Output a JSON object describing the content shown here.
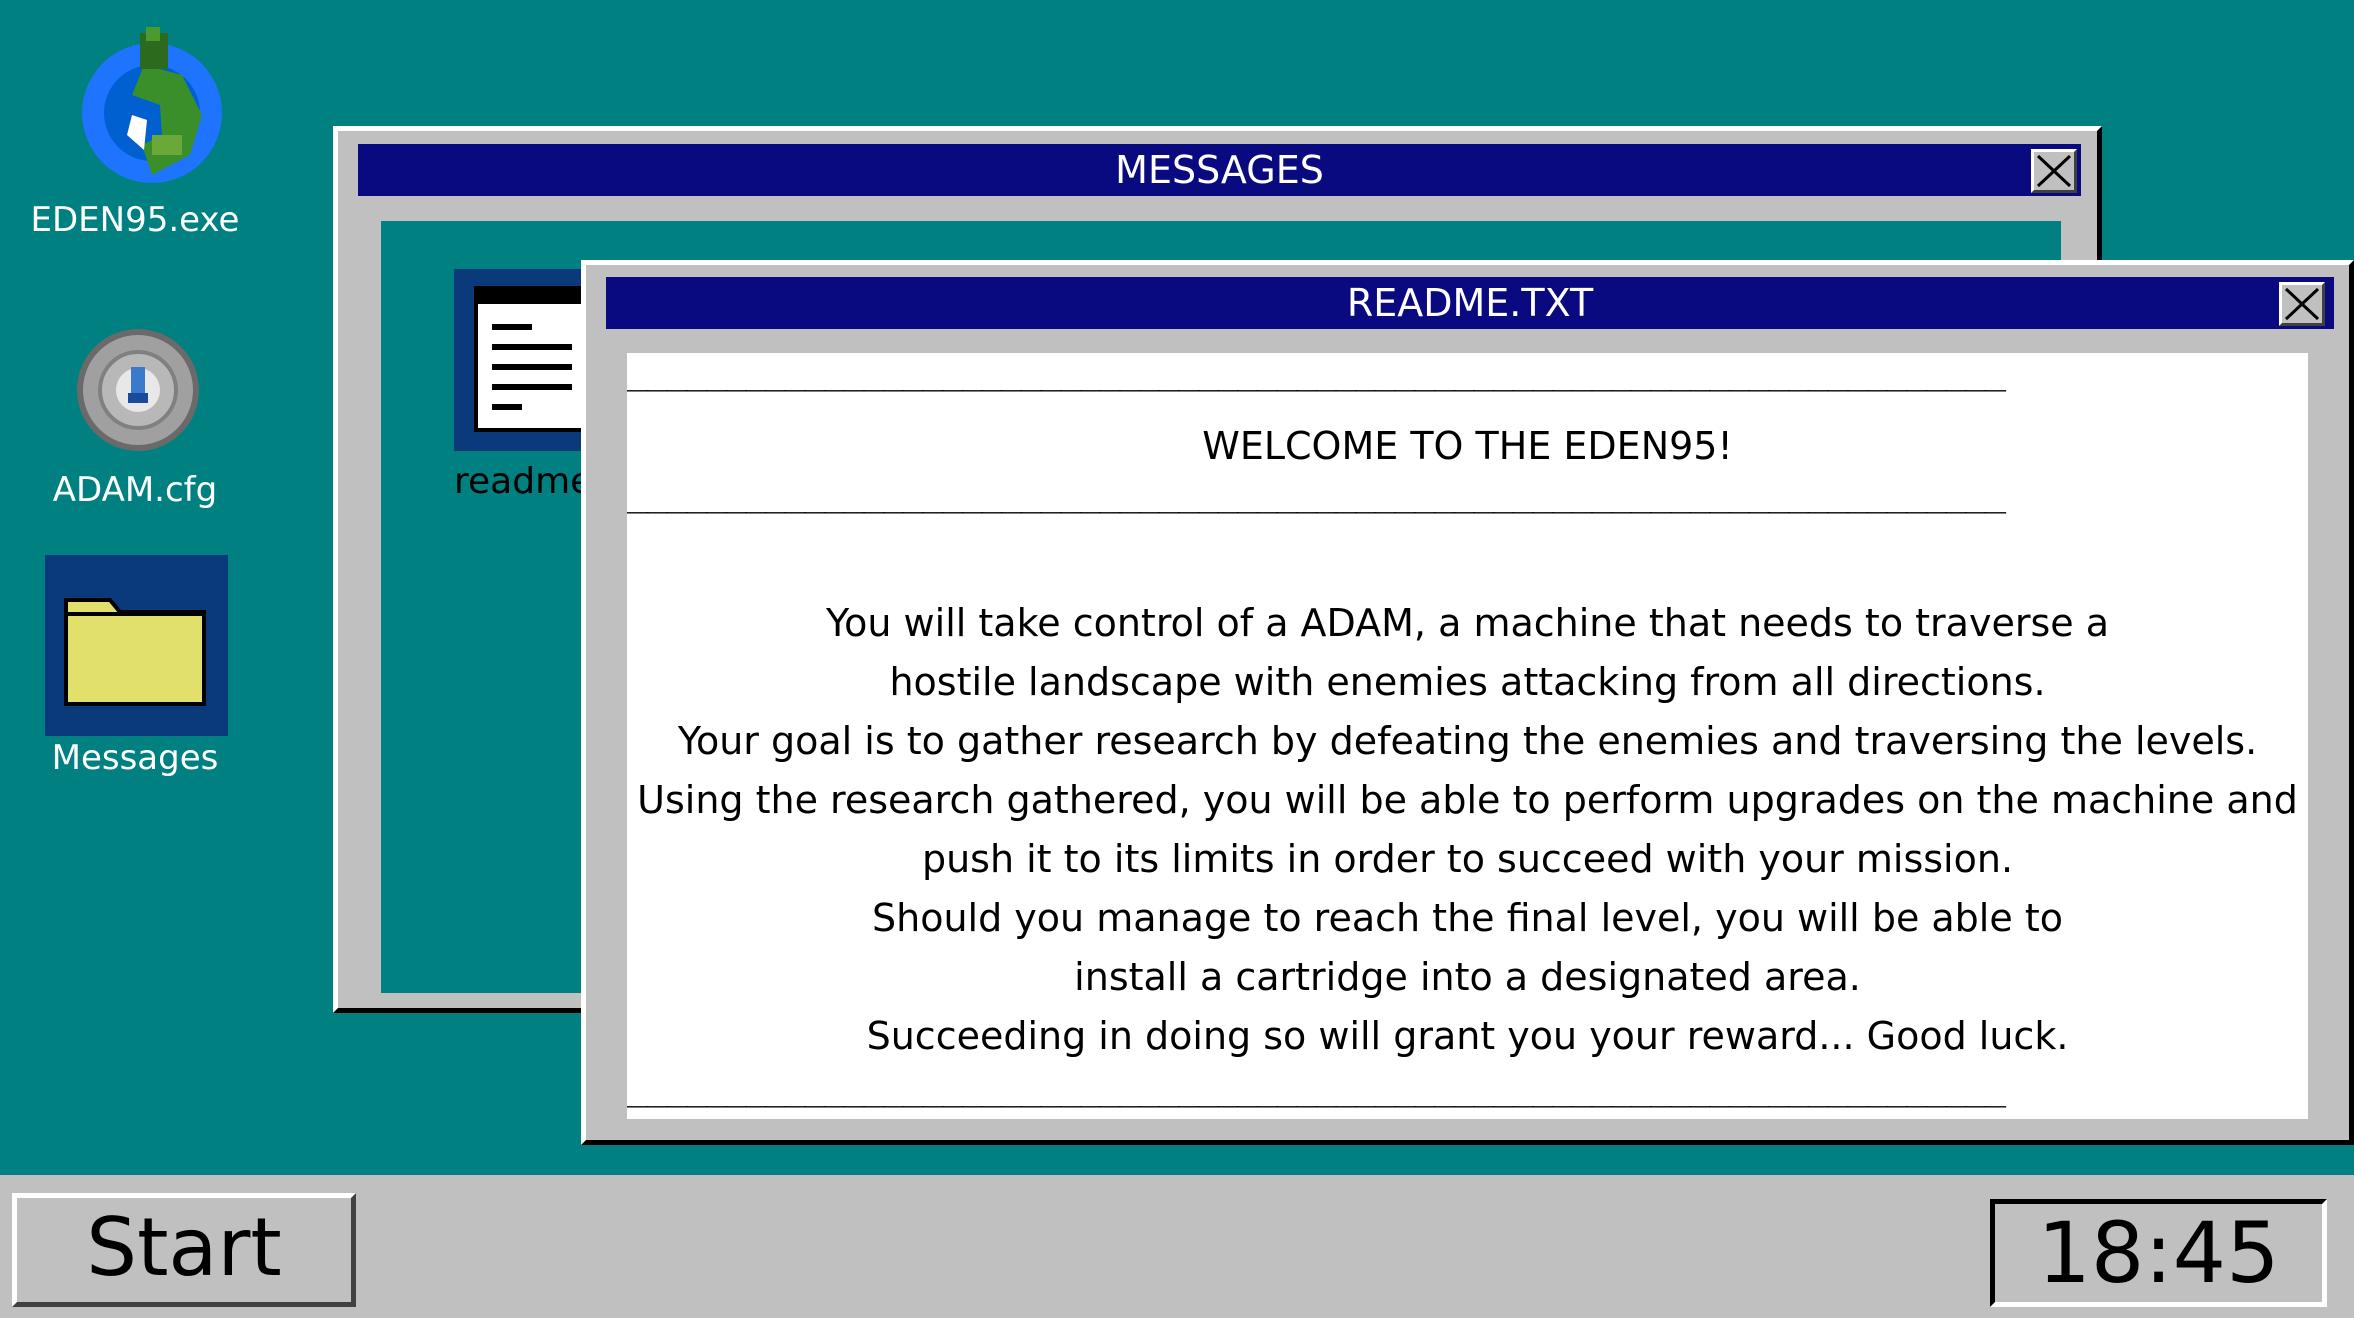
{
  "desktop": {
    "background": "#008080",
    "icons": [
      {
        "label": "EDEN95.exe",
        "icon": "globe-icon"
      },
      {
        "label": "ADAM.cfg",
        "icon": "settings-disc-icon"
      },
      {
        "label": "Messages",
        "icon": "folder-icon"
      }
    ]
  },
  "messages_window": {
    "title": "MESSAGES",
    "file_label": "readme",
    "file_icon": "text-document-icon"
  },
  "readme_window": {
    "title": "README.TXT",
    "separator": "______________________________________________________________________",
    "heading": "WELCOME TO THE EDEN95!",
    "lines": [
      "You will take control of a ADAM, a machine that needs to traverse a",
      "hostile landscape with enemies attacking from all directions.",
      "Your goal is to gather research by defeating the enemies and traversing the levels.",
      "Using the research gathered, you will be able to perform upgrades on the machine and",
      "push it to its limits in order to succeed with your mission.",
      "Should you manage to reach the final level, you will be able to",
      "install a cartridge into a designated area.",
      "Succeeding in doing so will grant you your reward... Good luck."
    ]
  },
  "taskbar": {
    "start_label": "Start",
    "clock": "18:45"
  },
  "colors": {
    "titlebar": "#0a0a80",
    "window": "#c0c0c0",
    "desktop": "#008080",
    "folder": "#e0e06a"
  }
}
